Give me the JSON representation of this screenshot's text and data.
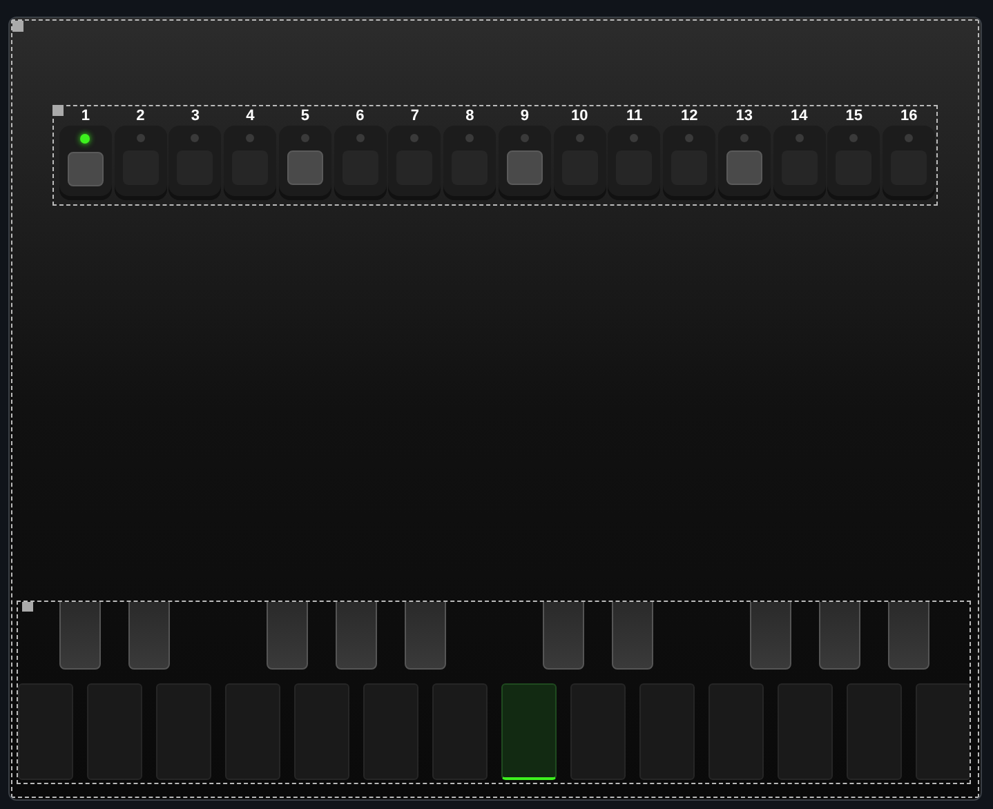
{
  "sequencer": {
    "steps": [
      {
        "label": "1",
        "led_on": true,
        "accent": true
      },
      {
        "label": "2",
        "led_on": false,
        "accent": false
      },
      {
        "label": "3",
        "led_on": false,
        "accent": false
      },
      {
        "label": "4",
        "led_on": false,
        "accent": false
      },
      {
        "label": "5",
        "led_on": false,
        "accent": true
      },
      {
        "label": "6",
        "led_on": false,
        "accent": false
      },
      {
        "label": "7",
        "led_on": false,
        "accent": false
      },
      {
        "label": "8",
        "led_on": false,
        "accent": false
      },
      {
        "label": "9",
        "led_on": false,
        "accent": true
      },
      {
        "label": "10",
        "led_on": false,
        "accent": false
      },
      {
        "label": "11",
        "led_on": false,
        "accent": false
      },
      {
        "label": "12",
        "led_on": false,
        "accent": false
      },
      {
        "label": "13",
        "led_on": false,
        "accent": true
      },
      {
        "label": "14",
        "led_on": false,
        "accent": false
      },
      {
        "label": "15",
        "led_on": false,
        "accent": false
      },
      {
        "label": "16",
        "led_on": false,
        "accent": false
      }
    ]
  },
  "keyboard": {
    "black_key_slots": [
      {
        "kind": "key",
        "pressed": false
      },
      {
        "kind": "key",
        "pressed": false
      },
      {
        "kind": "gap"
      },
      {
        "kind": "key",
        "pressed": false
      },
      {
        "kind": "key",
        "pressed": false
      },
      {
        "kind": "key",
        "pressed": false
      },
      {
        "kind": "gap"
      },
      {
        "kind": "key",
        "pressed": false
      },
      {
        "kind": "key",
        "pressed": false
      },
      {
        "kind": "gap"
      },
      {
        "kind": "key",
        "pressed": false
      },
      {
        "kind": "key",
        "pressed": false
      },
      {
        "kind": "key",
        "pressed": false
      }
    ],
    "white_keys": [
      {
        "pressed": false
      },
      {
        "pressed": false
      },
      {
        "pressed": false
      },
      {
        "pressed": false
      },
      {
        "pressed": false
      },
      {
        "pressed": false
      },
      {
        "pressed": false
      },
      {
        "pressed": true
      },
      {
        "pressed": false
      },
      {
        "pressed": false
      },
      {
        "pressed": false
      },
      {
        "pressed": false
      },
      {
        "pressed": false
      },
      {
        "pressed": false
      }
    ]
  }
}
